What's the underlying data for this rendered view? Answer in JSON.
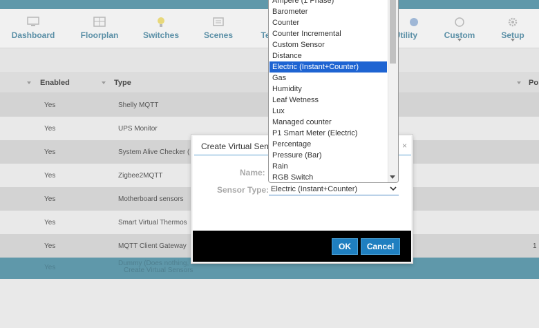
{
  "nav": [
    {
      "label": "Dashboard",
      "icon": "monitor-icon",
      "caret": false
    },
    {
      "label": "Floorplan",
      "icon": "floorplan-icon",
      "caret": false
    },
    {
      "label": "Switches",
      "icon": "lightbulb-icon",
      "caret": false
    },
    {
      "label": "Scenes",
      "icon": "scenes-icon",
      "caret": false
    },
    {
      "label": "Te",
      "icon": "thermometer-icon",
      "caret": false
    },
    {
      "label": "Utility",
      "icon": "utility-icon",
      "caret": false
    },
    {
      "label": "Custom",
      "icon": "custom-icon",
      "caret": true
    },
    {
      "label": "Setup",
      "icon": "gear-icon",
      "caret": true
    }
  ],
  "table": {
    "headers": {
      "enabled": "Enabled",
      "type": "Type",
      "extra": "Po"
    },
    "rows": [
      {
        "enabled": "Yes",
        "type": "Shelly MQTT",
        "extra": ""
      },
      {
        "enabled": "Yes",
        "type": "UPS Monitor",
        "extra": ""
      },
      {
        "enabled": "Yes",
        "type": "System Alive Checker (",
        "extra": ""
      },
      {
        "enabled": "Yes",
        "type": "Zigbee2MQTT",
        "extra": ""
      },
      {
        "enabled": "Yes",
        "type": "Motherboard sensors",
        "extra": ""
      },
      {
        "enabled": "Yes",
        "type": "Smart Virtual Thermos",
        "extra": ""
      },
      {
        "enabled": "Yes",
        "type": "MQTT Client Gateway",
        "extra": "1"
      },
      {
        "enabled": "Yes",
        "type": "Dummy (Does nothing,",
        "extra": ""
      }
    ],
    "selected_row_action": "Create Virtual Sensors"
  },
  "dialog": {
    "title": "Create Virtual Sens",
    "close": "×",
    "name_label": "Name:",
    "sensor_type_label": "Sensor Type:",
    "sensor_type_value": "Electric (Instant+Counter)",
    "ok_label": "OK",
    "cancel_label": "Cancel"
  },
  "dropdown": {
    "options": [
      "Ampere (1 Phase)",
      "Barometer",
      "Counter",
      "Counter Incremental",
      "Custom Sensor",
      "Distance",
      "Electric (Instant+Counter)",
      "Gas",
      "Humidity",
      "Leaf Wetness",
      "Lux",
      "Managed counter",
      "P1 Smart Meter (Electric)",
      "Percentage",
      "Pressure (Bar)",
      "Rain",
      "RGB Switch"
    ],
    "highlighted_index": 6
  },
  "colors": {
    "accent": "#5f98aa",
    "highlight": "#1e64d2",
    "button": "#1f7fc0"
  }
}
